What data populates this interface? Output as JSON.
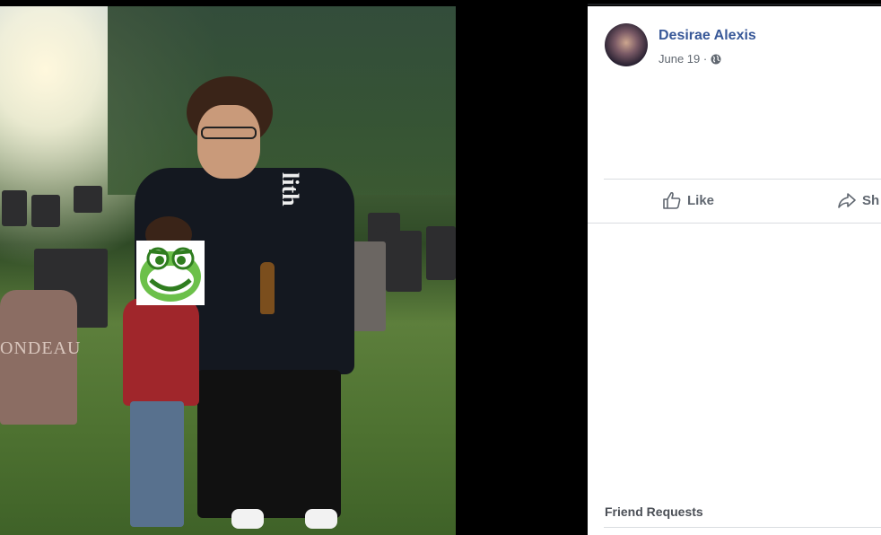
{
  "post": {
    "author_name": "Desirae Alexis",
    "date": "June 19 ·",
    "privacy_icon": "globe-icon"
  },
  "actions": {
    "like_label": "Like",
    "share_label": "Sh"
  },
  "sidebar": {
    "friend_requests_label": "Friend Requests"
  },
  "photo": {
    "gravestone_text": "ONDEAU",
    "hoodie_print": "lith"
  },
  "colors": {
    "link_blue": "#385898",
    "meta_gray": "#606770",
    "divider": "#dadde1"
  }
}
